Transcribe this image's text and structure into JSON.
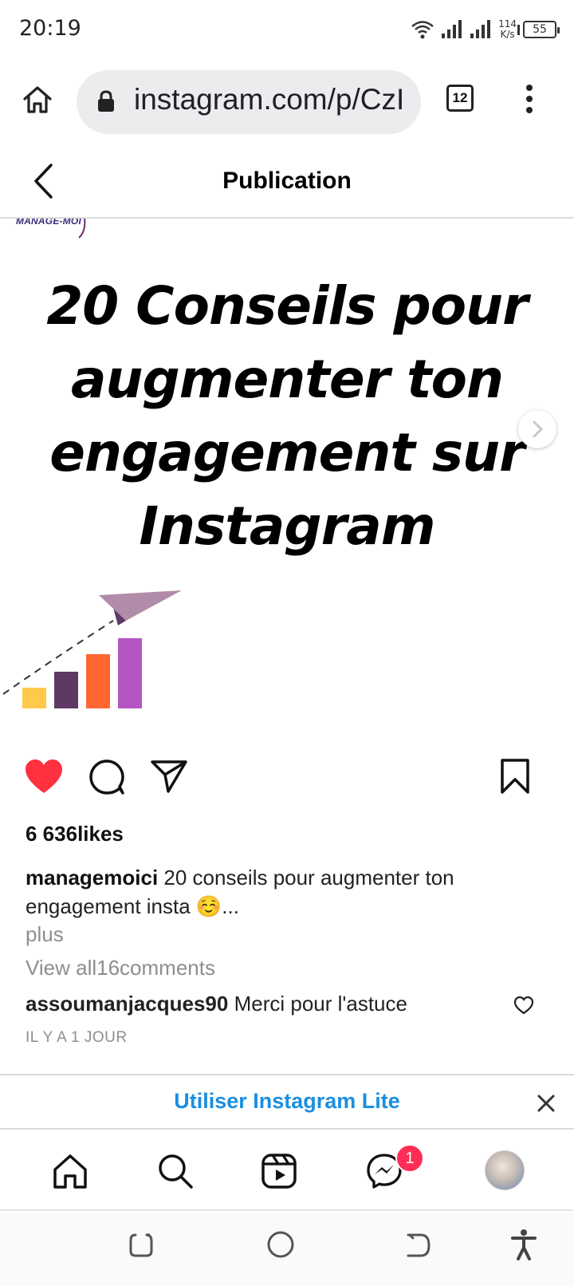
{
  "status_bar": {
    "time": "20:19",
    "speed_value": "114",
    "speed_unit": "K/s",
    "battery": "55"
  },
  "browser": {
    "url": "instagram.com/p/CzI",
    "tab_count": "12"
  },
  "header": {
    "title": "Publication"
  },
  "post": {
    "brand_logo": "MANAGE-MOI",
    "headline_lines": [
      "20 Conseils pour",
      "augmenter ton",
      "engagement sur",
      "Instagram"
    ],
    "liked": true,
    "likes": "6 636likes",
    "caption_user": "managemoici",
    "caption_text": "20 conseils pour augmenter ton engagement insta ☺️...",
    "more_label": "plus",
    "view_comments": "View all16comments",
    "comment": {
      "user": "assoumanjacques90",
      "text": "Merci pour l'astuce"
    },
    "time_ago": "IL Y A 1 JOUR",
    "colors": {
      "like_red": "#ff3040",
      "bar_yellow": "#ffc94a",
      "bar_purple_dark": "#5e3964",
      "bar_orange": "#ff6632",
      "bar_purple": "#b355c2",
      "plane": "#b18ca8"
    }
  },
  "lite_banner": {
    "label": "Utiliser Instagram Lite"
  },
  "bottom_nav": {
    "items": [
      "home-icon",
      "search-icon",
      "reels-icon",
      "messenger-icon",
      "profile-avatar"
    ],
    "message_badge": "1"
  },
  "system_nav": {
    "items": [
      "recents-icon",
      "home-circle-icon",
      "back-icon",
      "accessibility-icon"
    ]
  }
}
